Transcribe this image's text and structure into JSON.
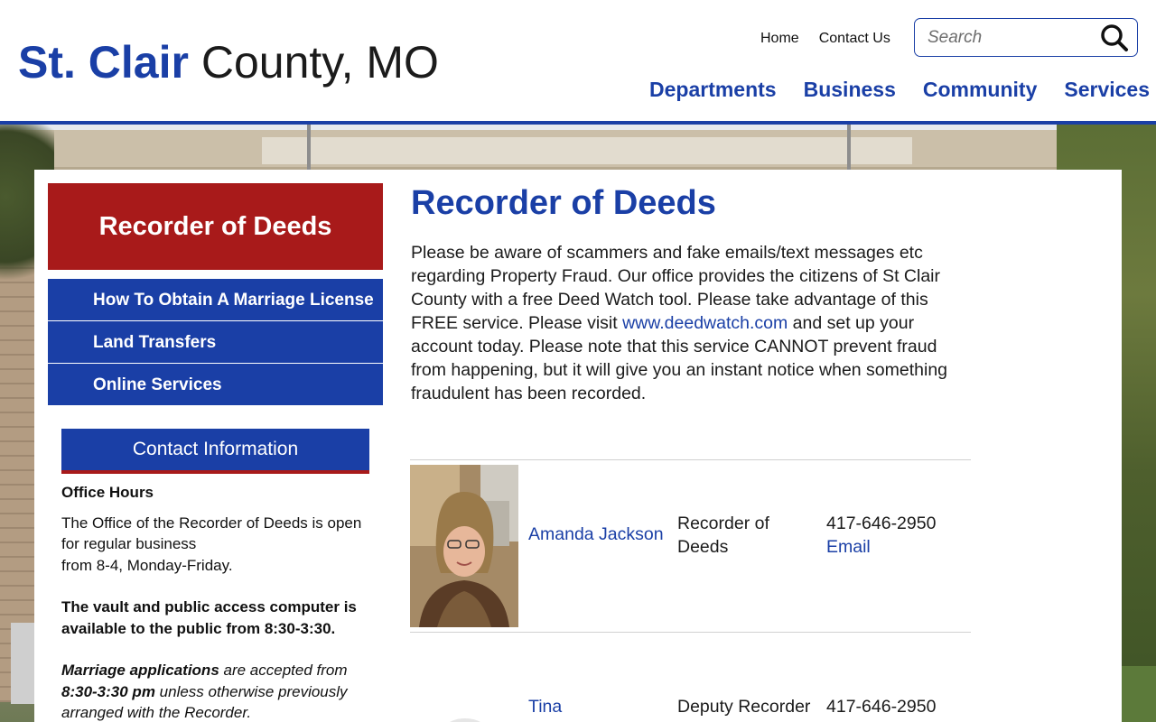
{
  "header": {
    "logo_bold": "St. Clair",
    "logo_light": "County, MO",
    "utility_links": [
      "Home",
      "Contact Us"
    ],
    "search_placeholder": "Search",
    "main_nav": [
      "Departments",
      "Business",
      "Community",
      "Services"
    ]
  },
  "sidebar": {
    "title": "Recorder of Deeds",
    "menu": [
      "How To Obtain A Marriage License",
      "Land Transfers",
      "Online Services"
    ],
    "contact": {
      "heading": "Contact Information",
      "hours_label": "Office Hours",
      "hours_text_1": "The Office of the Recorder of Deeds is open for regular business",
      "hours_text_2": "from 8-4, Monday-Friday.",
      "vault_text": "The vault and public access computer is available to the public from 8:30-3:30.",
      "marriage_bold": "Marriage applications",
      "marriage_text_1": " are accepted from ",
      "marriage_time": "8:30-3:30 pm",
      "marriage_text_2": " unless otherwise previously arranged with the Recorder."
    }
  },
  "main": {
    "title": "Recorder of Deeds",
    "intro_before": "Please be aware of scammers and fake emails/text messages etc regarding Property Fraud.  Our office provides the citizens of St Clair County with a free Deed Watch tool.  Please take advantage of this FREE service.  Please visit ",
    "intro_link": "www.deedwatch.com",
    "intro_after": " and set up your account today.  Please note that this service CANNOT prevent fraud from happening, but it will give you an instant notice when something fraudulent has been recorded.",
    "staff": [
      {
        "name": "Amanda Jackson",
        "title": "Recorder of Deeds",
        "phone": "417-646-2950",
        "email_label": "Email"
      },
      {
        "name": "Tina",
        "title": "Deputy Recorder",
        "phone": "417-646-2950"
      }
    ]
  },
  "colors": {
    "brand_blue": "#1a3fa6",
    "brand_red": "#a81a1a"
  },
  "icons": {
    "search": "search-icon",
    "staff_photo": "staff-photo"
  }
}
